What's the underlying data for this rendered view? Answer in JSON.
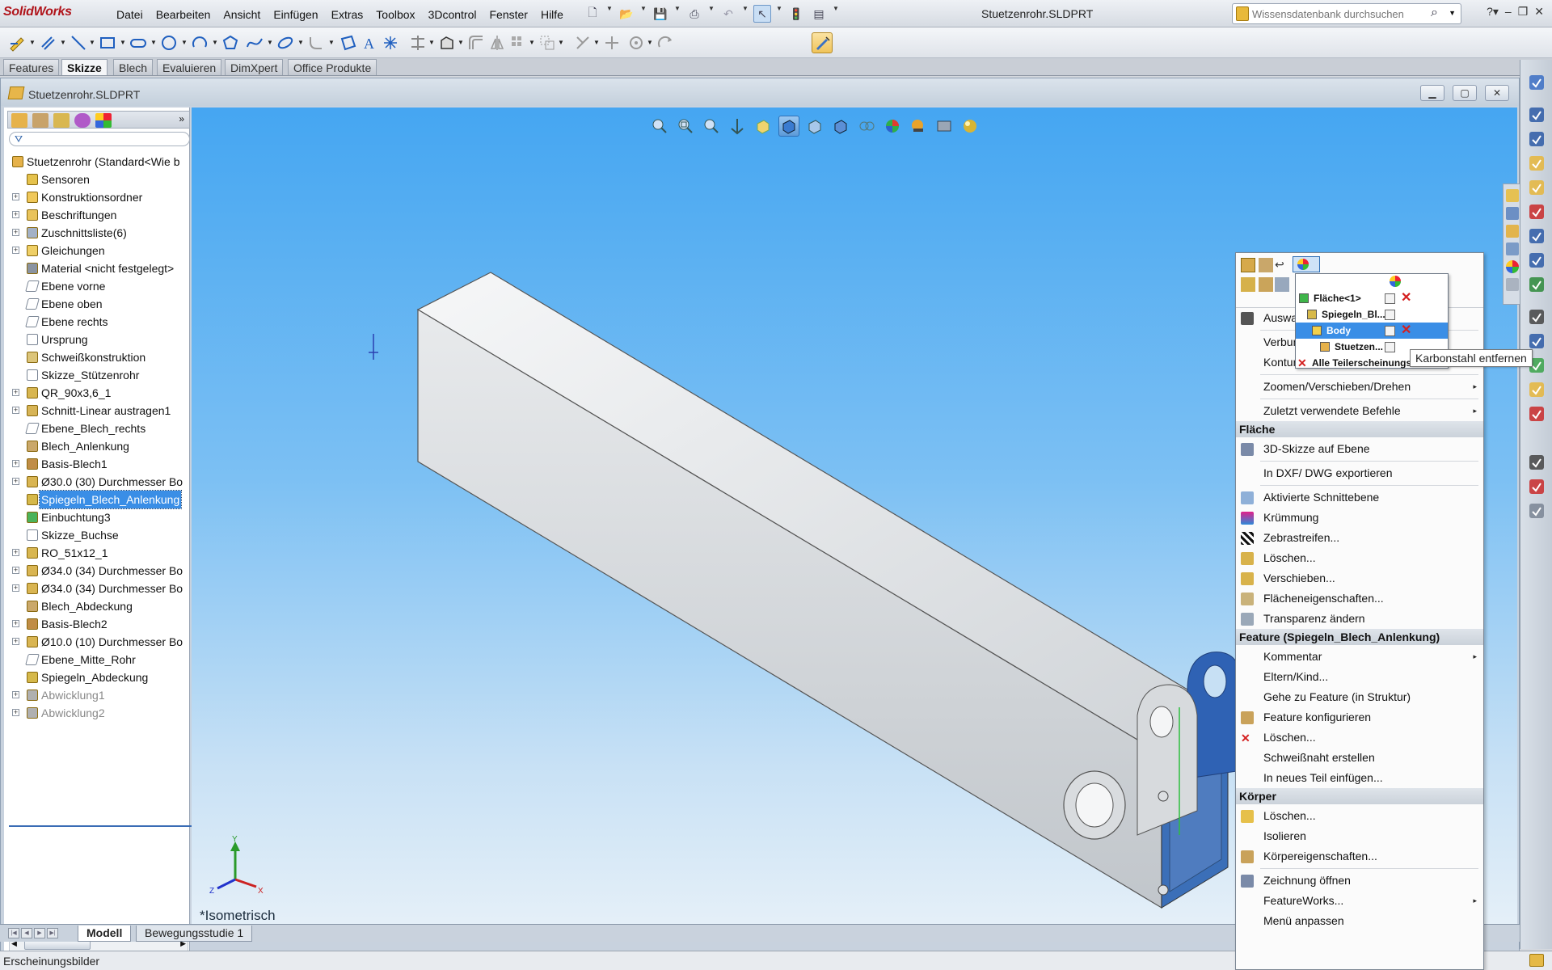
{
  "app": {
    "logo": "SolidWorks",
    "document_title": "Stuetzenrohr.SLDPRT",
    "search_placeholder": "Wissensdatenbank durchsuchen"
  },
  "menu": [
    "Datei",
    "Bearbeiten",
    "Ansicht",
    "Einfügen",
    "Extras",
    "Toolbox",
    "3Dcontrol",
    "Fenster",
    "Hilfe"
  ],
  "command_tabs": [
    {
      "label": "Features",
      "active": false
    },
    {
      "label": "Skizze",
      "active": true
    },
    {
      "label": "Blech",
      "active": false
    },
    {
      "label": "Evaluieren",
      "active": false
    },
    {
      "label": "DimXpert",
      "active": false
    },
    {
      "label": "Office Produkte",
      "active": false
    }
  ],
  "doc_window": {
    "title": "Stuetzenrohr.SLDPRT"
  },
  "feature_tree": [
    {
      "label": "Stuetzenrohr  (Standard<Wie b",
      "icon": "part-icon",
      "expand": false,
      "root": true
    },
    {
      "label": "Sensoren",
      "icon": "sensor-icon",
      "expand": false
    },
    {
      "label": "Konstruktionsordner",
      "icon": "folder-icon",
      "expand": true
    },
    {
      "label": "Beschriftungen",
      "icon": "annotation-icon",
      "expand": true
    },
    {
      "label": "Zuschnittsliste(6)",
      "icon": "cutlist-icon",
      "expand": true
    },
    {
      "label": "Gleichungen",
      "icon": "equation-icon",
      "expand": true
    },
    {
      "label": "Material <nicht festgelegt>",
      "icon": "material-icon",
      "expand": false
    },
    {
      "label": "Ebene vorne",
      "icon": "plane-icon",
      "expand": false
    },
    {
      "label": "Ebene oben",
      "icon": "plane-icon",
      "expand": false
    },
    {
      "label": "Ebene rechts",
      "icon": "plane-icon",
      "expand": false
    },
    {
      "label": "Ursprung",
      "icon": "origin-icon",
      "expand": false
    },
    {
      "label": "Schweißkonstruktion",
      "icon": "weldment-icon",
      "expand": false
    },
    {
      "label": "Skizze_Stützenrohr",
      "icon": "sketch-icon",
      "expand": false
    },
    {
      "label": "QR_90x3,6_1",
      "icon": "structure-icon",
      "expand": true
    },
    {
      "label": "Schnitt-Linear austragen1",
      "icon": "cut-icon",
      "expand": true
    },
    {
      "label": "Ebene_Blech_rechts",
      "icon": "plane-icon",
      "expand": false
    },
    {
      "label": "Blech_Anlenkung",
      "icon": "sheetmetal-icon",
      "expand": false
    },
    {
      "label": "Basis-Blech1",
      "icon": "baseflange-icon",
      "expand": true
    },
    {
      "label": "Ø30.0 (30) Durchmesser Bo",
      "icon": "hole-icon",
      "expand": true
    },
    {
      "label": "Spiegeln_Blech_Anlenkung",
      "icon": "mirror-icon",
      "expand": false,
      "selected": true
    },
    {
      "label": "Einbuchtung3",
      "icon": "indent-icon",
      "expand": false
    },
    {
      "label": "Skizze_Buchse",
      "icon": "sketch-icon",
      "expand": false
    },
    {
      "label": "RO_51x12_1",
      "icon": "structure-icon",
      "expand": true
    },
    {
      "label": "Ø34.0 (34) Durchmesser Bo",
      "icon": "hole-icon",
      "expand": true
    },
    {
      "label": "Ø34.0 (34) Durchmesser Bo",
      "icon": "hole-icon",
      "expand": true
    },
    {
      "label": "Blech_Abdeckung",
      "icon": "sheetmetal-icon",
      "expand": false
    },
    {
      "label": "Basis-Blech2",
      "icon": "baseflange-icon",
      "expand": true
    },
    {
      "label": "Ø10.0 (10) Durchmesser Bo",
      "icon": "hole-icon",
      "expand": true
    },
    {
      "label": "Ebene_Mitte_Rohr",
      "icon": "plane-icon",
      "expand": false
    },
    {
      "label": "Spiegeln_Abdeckung",
      "icon": "mirror-icon",
      "expand": false
    },
    {
      "label": "Abwicklung1",
      "icon": "flatpattern-icon",
      "expand": true,
      "dim": true
    },
    {
      "label": "Abwicklung2",
      "icon": "flatpattern-icon",
      "expand": true,
      "dim": true
    }
  ],
  "viewport": {
    "view_label": "*Isometrisch",
    "triad": {
      "x": "X",
      "y": "Y",
      "z": "Z"
    }
  },
  "bottom_tabs": [
    {
      "label": "Modell",
      "active": true
    },
    {
      "label": "Bewegungsstudie 1",
      "active": false
    }
  ],
  "status_bar": {
    "text": "Erscheinungsbilder"
  },
  "appearance_panel": {
    "rows": [
      {
        "label": "Fläche<1>",
        "icon": "face-icon",
        "swatch": "#3fb54a",
        "delete": true
      },
      {
        "label": "Spiegeln_Bl...",
        "icon": "mirror-icon",
        "swatch": "#d7b94a",
        "delete": false
      },
      {
        "label": "Body",
        "icon": "body-icon",
        "swatch": "#f2d04b",
        "delete": true,
        "selected": true
      },
      {
        "label": "Stuetzen...",
        "icon": "part-icon",
        "swatch": "#e6b14a",
        "delete": false
      },
      {
        "label": "Alle Teilerscheinungsbilder",
        "icon": "delete-icon",
        "swatch": "",
        "delete": false
      }
    ],
    "tooltip": "Karbonstahl entfernen"
  },
  "context_menu": {
    "items_top": [
      {
        "label": "Auswahl",
        "icon": "cursor-icon",
        "submenu": false
      },
      {
        "label": "Verbundene Kanten",
        "icon": "",
        "submenu": false
      },
      {
        "label": "Konturenauswahl-Werkzeug",
        "icon": "",
        "submenu": false
      },
      {
        "label": "Zoomen/Verschieben/Drehen",
        "icon": "",
        "submenu": true
      },
      {
        "label": "Zuletzt verwendete Befehle",
        "icon": "",
        "submenu": true
      }
    ],
    "section_face": "Fläche",
    "face_items": [
      {
        "label": "3D-Skizze auf Ebene",
        "icon": "sketch3d-icon"
      },
      {
        "label": "In DXF/ DWG exportieren",
        "icon": ""
      },
      {
        "label": "Aktivierte Schnittebene",
        "icon": "section-icon"
      },
      {
        "label": "Krümmung",
        "icon": "curvature-icon"
      },
      {
        "label": "Zebrastreifen...",
        "icon": "zebra-icon"
      },
      {
        "label": "Löschen...",
        "icon": "delete-face-icon"
      },
      {
        "label": "Verschieben...",
        "icon": "move-face-icon"
      },
      {
        "label": "Flächeneigenschaften...",
        "icon": "face-props-icon"
      },
      {
        "label": "Transparenz ändern",
        "icon": "transparency-icon"
      }
    ],
    "section_feature": "Feature (Spiegeln_Blech_Anlenkung)",
    "feature_items": [
      {
        "label": "Kommentar",
        "icon": "",
        "submenu": true
      },
      {
        "label": "Eltern/Kind...",
        "icon": "",
        "submenu": false
      },
      {
        "label": "Gehe zu Feature (in Struktur)",
        "icon": "",
        "submenu": false
      },
      {
        "label": "Feature konfigurieren",
        "icon": "configure-icon",
        "submenu": false
      },
      {
        "label": "Löschen...",
        "icon": "delete-icon",
        "submenu": false
      },
      {
        "label": "Schweißnaht erstellen",
        "icon": "",
        "submenu": false
      },
      {
        "label": "In neues Teil einfügen...",
        "icon": "",
        "submenu": false
      }
    ],
    "section_body": "Körper",
    "body_items": [
      {
        "label": "Löschen...",
        "icon": "delete-body-icon",
        "submenu": false
      },
      {
        "label": "Isolieren",
        "icon": "",
        "submenu": false
      },
      {
        "label": "Körpereigenschaften...",
        "icon": "body-props-icon",
        "submenu": false
      },
      {
        "label": "Zeichnung öffnen",
        "icon": "drawing-icon",
        "submenu": false
      },
      {
        "label": "FeatureWorks...",
        "icon": "",
        "submenu": true
      },
      {
        "label": "Menü anpassen",
        "icon": "",
        "submenu": false
      }
    ]
  }
}
